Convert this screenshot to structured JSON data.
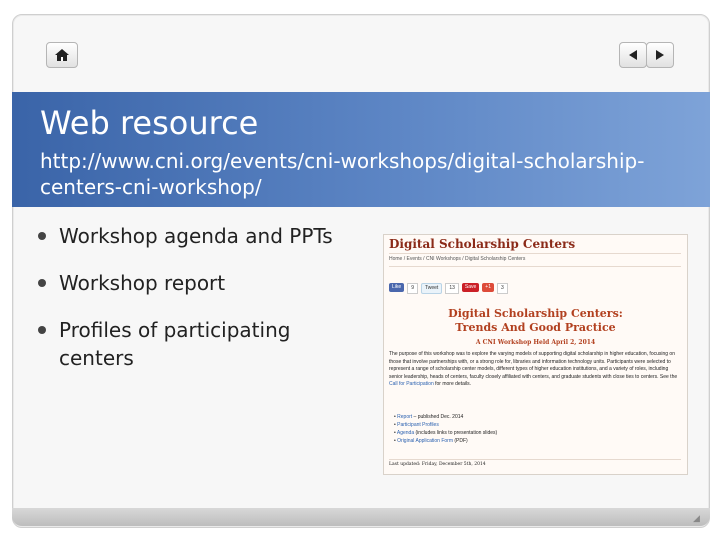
{
  "slide": {
    "title": "Web resource",
    "url": "http://www.cni.org/events/cni-workshops/digital-scholarship-centers-cni-workshop/",
    "bullets": [
      "Workshop agenda and PPTs",
      "Workshop report",
      "Profiles of participating centers"
    ]
  },
  "nav": {
    "home_icon": "home-icon",
    "prev_icon": "arrow-left-icon",
    "next_icon": "arrow-right-icon"
  },
  "screenshot": {
    "title": "Digital Scholarship Centers",
    "breadcrumb": "Home / Events / CNI Workshops / Digital Scholarship Centers",
    "social": {
      "like": "Like",
      "like_count": "9",
      "tweet": "Tweet",
      "tweet_count": "13",
      "save": "Save",
      "plus": "+1",
      "plus_count": "3"
    },
    "heading_line1": "Digital Scholarship Centers:",
    "heading_line2": "Trends And Good Practice",
    "subheading": "A CNI Workshop Held April 2, 2014",
    "paragraph_pre": "The purpose of this workshop was to explore the varying models of supporting digital scholarship in higher education, focusing on those that involve partnerships with, or a strong role for, libraries and information technology units. Participants were selected to represent a range of scholarship center models, different types of higher education institutions, and a variety of roles, including senior leadership, heads of centers, faculty closely affiliated with centers, and graduate students with close ties to centers. See the ",
    "paragraph_link": "Call for Participation",
    "paragraph_post": " for more details.",
    "list": [
      {
        "link": "Report",
        "rest": " – published Dec. 2014"
      },
      {
        "link": "Participant Profiles",
        "rest": ""
      },
      {
        "link": "Agenda",
        "rest": " (includes links to presentation slides)"
      },
      {
        "link": "Original Application Form",
        "rest": " (PDF)"
      }
    ],
    "last_updated": "Last updated: Friday, December 5th, 2014"
  },
  "colors": {
    "header_start": "#3a64a8",
    "header_end": "#7ea3d8",
    "accent_red": "#b2401f"
  }
}
